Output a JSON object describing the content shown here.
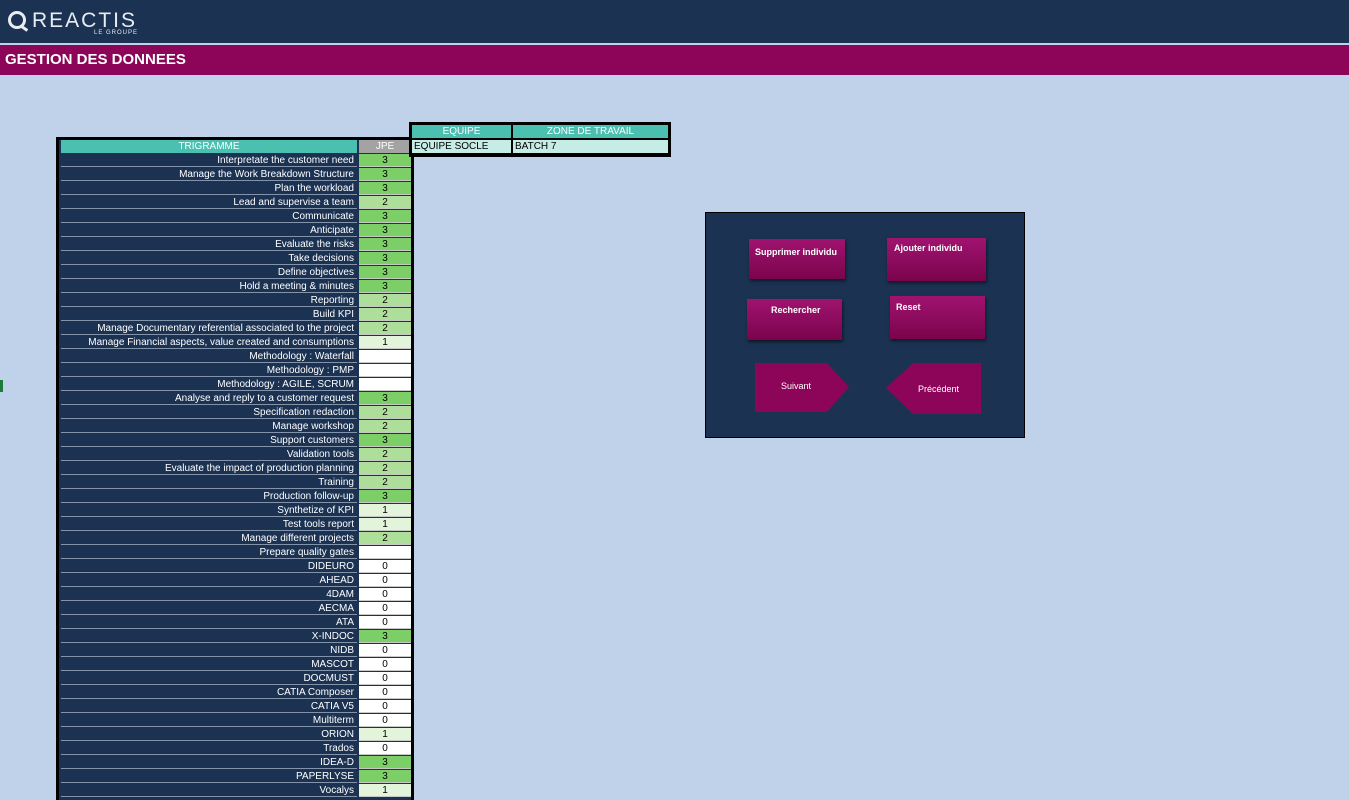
{
  "header": {
    "logo_text": "REACTIS",
    "logo_sub": "LE GROUPE",
    "page_title": "GESTION DES DONNEES"
  },
  "colors": {
    "topbar": "#1b3252",
    "titlebar": "#8c0558",
    "background": "#c0d2ea",
    "header_teal": "#4bbfb0",
    "level_3": "#7ccf66",
    "level_2": "#addf9a",
    "level_1": "#e2f5da",
    "level_0": "#ffffff",
    "button": "#8c0558"
  },
  "skills_table": {
    "col_label_header": "TRIGRAMME",
    "col_value_header": "JPE",
    "rows": [
      {
        "label": "Interpretate the customer need",
        "value": "3"
      },
      {
        "label": "Manage the Work Breakdown Structure",
        "value": "3"
      },
      {
        "label": "Plan the workload",
        "value": "3"
      },
      {
        "label": "Lead and supervise a team",
        "value": "2"
      },
      {
        "label": "Communicate",
        "value": "3"
      },
      {
        "label": "Anticipate",
        "value": "3"
      },
      {
        "label": "Evaluate the risks",
        "value": "3"
      },
      {
        "label": "Take decisions",
        "value": "3"
      },
      {
        "label": "Define objectives",
        "value": "3"
      },
      {
        "label": "Hold a meeting & minutes",
        "value": "3"
      },
      {
        "label": "Reporting",
        "value": "2"
      },
      {
        "label": "Build KPI",
        "value": "2"
      },
      {
        "label": "Manage Documentary referential associated to the project",
        "value": "2"
      },
      {
        "label": "Manage Financial aspects, value created and consumptions",
        "value": "1"
      },
      {
        "label": "Methodology : Waterfall",
        "value": ""
      },
      {
        "label": "Methodology : PMP",
        "value": ""
      },
      {
        "label": "Methodology : AGILE, SCRUM",
        "value": ""
      },
      {
        "label": "Analyse and reply to a customer request",
        "value": "3"
      },
      {
        "label": "Specification redaction",
        "value": "2"
      },
      {
        "label": "Manage workshop",
        "value": "2"
      },
      {
        "label": "Support customers",
        "value": "3"
      },
      {
        "label": "Validation tools",
        "value": "2"
      },
      {
        "label": "Evaluate the impact of production planning",
        "value": "2"
      },
      {
        "label": "Training",
        "value": "2"
      },
      {
        "label": "Production follow-up",
        "value": "3"
      },
      {
        "label": "Synthetize of KPI",
        "value": "1"
      },
      {
        "label": "Test tools report",
        "value": "1"
      },
      {
        "label": "Manage different projects",
        "value": "2"
      },
      {
        "label": "Prepare quality gates",
        "value": ""
      },
      {
        "label": "DIDEURO",
        "value": "0"
      },
      {
        "label": "AHEAD",
        "value": "0"
      },
      {
        "label": "4DAM",
        "value": "0"
      },
      {
        "label": "AECMA",
        "value": "0"
      },
      {
        "label": "ATA",
        "value": "0"
      },
      {
        "label": "X-INDOC",
        "value": "3"
      },
      {
        "label": "NIDB",
        "value": "0"
      },
      {
        "label": "MASCOT",
        "value": "0"
      },
      {
        "label": "DOCMUST",
        "value": "0"
      },
      {
        "label": "CATIA Composer",
        "value": "0"
      },
      {
        "label": "CATIA V5",
        "value": "0"
      },
      {
        "label": "Multiterm",
        "value": "0"
      },
      {
        "label": "ORION",
        "value": "1"
      },
      {
        "label": "Trados",
        "value": "0"
      },
      {
        "label": "IDEA-D",
        "value": "3"
      },
      {
        "label": "PAPERLYSE",
        "value": "3"
      },
      {
        "label": "Vocalys",
        "value": "1"
      }
    ]
  },
  "team_table": {
    "headers": [
      "EQUIPE",
      "ZONE DE TRAVAIL"
    ],
    "values": [
      "EQUIPE SOCLE",
      "BATCH 7"
    ]
  },
  "panel": {
    "delete_label": "Supprimer individu",
    "add_label": "Ajouter individu",
    "search_label": "Rechercher",
    "reset_label": "Reset",
    "next_label": "Suivant",
    "prev_label": "Précédent"
  }
}
